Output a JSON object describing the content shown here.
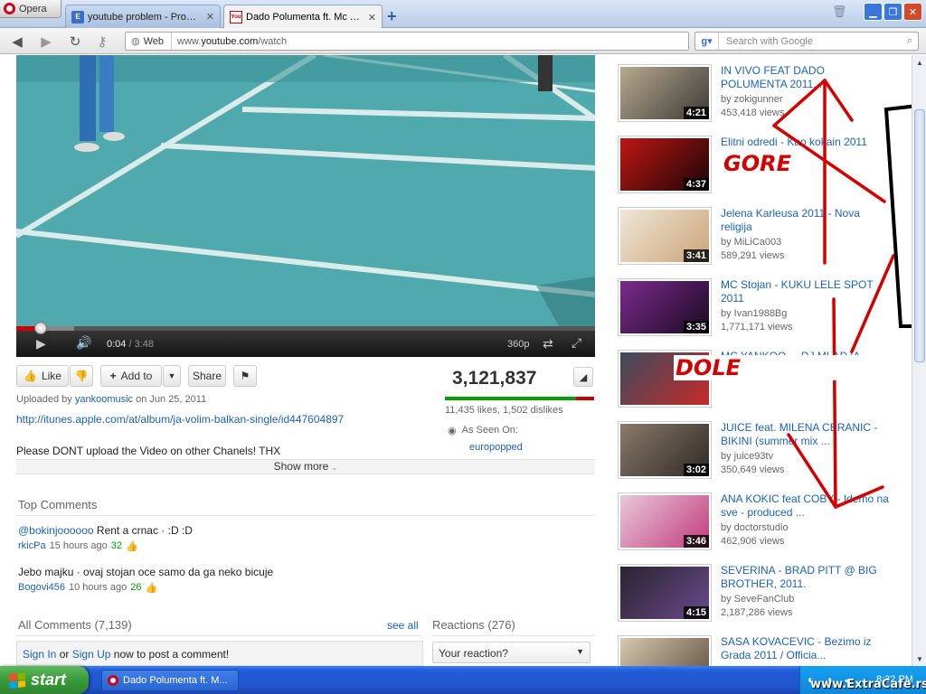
{
  "browser": {
    "menu_label": "Opera",
    "tabs": [
      {
        "label": "youtube problem - Progr...",
        "favicon": "E"
      },
      {
        "label": "Dado Polumenta ft. Mc Y...",
        "favicon": "You"
      }
    ],
    "new_tab": "+",
    "address": {
      "mode_label": "Web",
      "url_prefix": "www.",
      "url_domain": "youtube.com",
      "url_path": "/watch"
    },
    "search_placeholder": "Search with Google"
  },
  "player": {
    "current_time": "0:04",
    "duration": "3:48",
    "time_separator": " / ",
    "quality": "360p",
    "progress_fraction": 0.018
  },
  "actions": {
    "like_label": "Like",
    "add_to_label": "Add to",
    "share_label": "Share"
  },
  "stats": {
    "view_count": "3,121,837",
    "likes_dislikes": "11,435 likes, 1,502 dislikes",
    "as_seen_on_label": "As Seen On:",
    "as_seen_on_site": "europopped"
  },
  "description": {
    "uploaded_prefix": "Uploaded by",
    "uploader": "yankoomusic",
    "uploaded_on": "on Jun 25, 2011",
    "itunes_link": "http://itunes.apple.com/at/album/ja-volim-balkan-single/id447604897",
    "text": "Please DONT upload the Video on other Chanels! THX",
    "show_more": "Show more"
  },
  "top_comments": {
    "heading": "Top Comments",
    "items": [
      {
        "text_mention": "@bokinjoooooo",
        "text": " Rent a crnac · :D :D",
        "author": "rkicPa",
        "time": "15 hours ago",
        "votes": "32"
      },
      {
        "text_mention": "",
        "text": "Jebo majku · ovaj stojan oce samo da ga neko bicuje",
        "author": "Bogovi456",
        "time": "10 hours ago",
        "votes": "26"
      }
    ]
  },
  "all_comments": {
    "heading": "All Comments (7,139)",
    "see_all": "see all",
    "sign_in": "Sign In",
    "or": "or",
    "sign_up": "Sign Up",
    "prompt": "now to post a comment!"
  },
  "reactions": {
    "heading": "Reactions (276)",
    "select_value": "Your reaction?"
  },
  "related": [
    {
      "title": "IN VIVO FEAT DADO POLUMENTA 2011...",
      "by": "by zokigunner",
      "views": "453,418 views",
      "duration": "4:21",
      "color1": "#b6a98f",
      "color2": "#3d3a36"
    },
    {
      "title": "Elitni odredi - Kao kokain 2011",
      "by": "",
      "views": "",
      "duration": "4:37",
      "color1": "#c01515",
      "color2": "#1a0606"
    },
    {
      "title": "Jelena Karleusa 2011 - Nova religija",
      "by": "by MiLiCa003",
      "views": "589,291 views",
      "duration": "3:41",
      "color1": "#f0e6d6",
      "color2": "#caa47a"
    },
    {
      "title": "MC Stojan - KUKU LELE SPOT 2011",
      "by": "by Ivan1988Bg",
      "views": "1,771,171 views",
      "duration": "3:35",
      "color1": "#7a2a8c",
      "color2": "#1a0a22"
    },
    {
      "title": "MC YANKOO ... DJ MLADJA ... OFFICIAL ...",
      "by": "",
      "views": "",
      "duration": "",
      "color1": "#3a4c5c",
      "color2": "#c62a2a"
    },
    {
      "title": "JUICE feat. MILENA CERANIC - BIKINI (summer mix ...",
      "by": "by juice93tv",
      "views": "350,649 views",
      "duration": "3:02",
      "color1": "#8a7a6a",
      "color2": "#2e2a26"
    },
    {
      "title": "ANA KOKIC feat COBY - Idemo na sve - produced ...",
      "by": "by doctorstudio",
      "views": "462,906 views",
      "duration": "3:46",
      "color1": "#e8c8d8",
      "color2": "#c23b7e"
    },
    {
      "title": "SEVERINA - BRAD PITT @ BIG BROTHER, 2011.",
      "by": "by SeveFanClub",
      "views": "2,187,286 views",
      "duration": "4:15",
      "color1": "#2a2430",
      "color2": "#6a4a8a"
    },
    {
      "title": "SASA KOVACEVIC - Bezimo iz Grada 2011 / Officia...",
      "by": "",
      "views": "",
      "duration": "",
      "color1": "#d8c8b0",
      "color2": "#5a4a3a"
    }
  ],
  "annotations": {
    "up_label": "GORE",
    "down_label": "DOLE",
    "color": "#d40000"
  },
  "taskbar": {
    "start_label": "start",
    "task_label": "Dado Polumenta ft. M...",
    "clock": "8:32 PM"
  },
  "watermark": "www.ExtraCafe.rs",
  "colors": {
    "link": "#1c62b9",
    "like_green": "#00a000",
    "dislike_red": "#cc0000"
  }
}
